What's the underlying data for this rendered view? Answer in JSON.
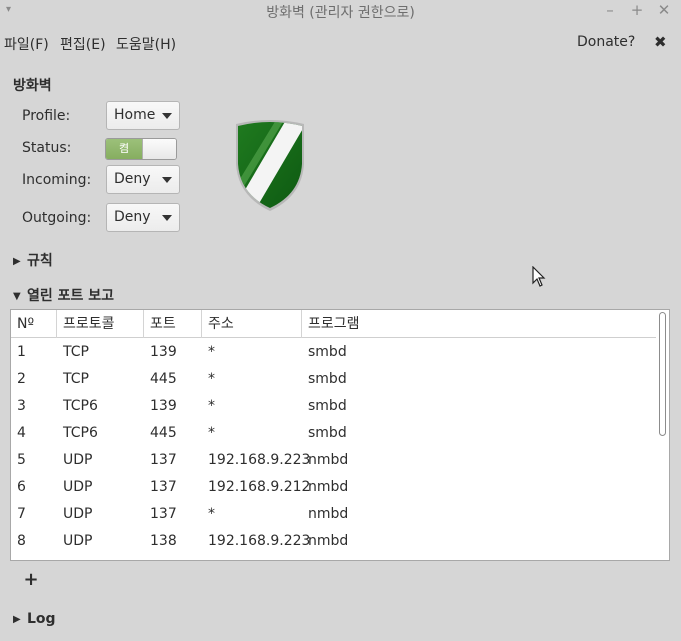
{
  "window": {
    "title": "방화벽 (관리자 권한으로)",
    "menu_arrow": "▾",
    "minimize": "–",
    "maximize": "+",
    "close": "✕"
  },
  "menubar": {
    "file": "파일(F)",
    "edit": "편집(E)",
    "help": "도움말(H)",
    "donate": "Donate?",
    "close": "✖"
  },
  "firewall": {
    "section_title": "방화벽",
    "profile_label": "Profile:",
    "profile_value": "Home",
    "status_label": "Status:",
    "status_value": "켬",
    "status_on": true,
    "incoming_label": "Incoming:",
    "incoming_value": "Deny",
    "outgoing_label": "Outgoing:",
    "outgoing_value": "Deny"
  },
  "rules": {
    "label": "규칙",
    "expanded": false
  },
  "report": {
    "label": "열린 포트 보고",
    "expanded": true,
    "columns": [
      "Nº",
      "프로토콜",
      "포트",
      "주소",
      "프로그램"
    ],
    "rows": [
      [
        "1",
        "TCP",
        "139",
        "*",
        "smbd"
      ],
      [
        "2",
        "TCP",
        "445",
        "*",
        "smbd"
      ],
      [
        "3",
        "TCP6",
        "139",
        "*",
        "smbd"
      ],
      [
        "4",
        "TCP6",
        "445",
        "*",
        "smbd"
      ],
      [
        "5",
        "UDP",
        "137",
        "192.168.9.223",
        "nmbd"
      ],
      [
        "6",
        "UDP",
        "137",
        "192.168.9.212",
        "nmbd"
      ],
      [
        "7",
        "UDP",
        "137",
        "*",
        "nmbd"
      ],
      [
        "8",
        "UDP",
        "138",
        "192.168.9.223",
        "nmbd"
      ]
    ],
    "add_label": "+"
  },
  "log": {
    "label": "Log",
    "expanded": false
  },
  "icons": {
    "shield": "shield-icon",
    "expander_collapsed": "▶",
    "expander_expanded": "▼"
  },
  "colors": {
    "window_bg": "#d6d6d6",
    "switch_on": "#8fb66a",
    "shield_green": "#2f8a2f"
  }
}
